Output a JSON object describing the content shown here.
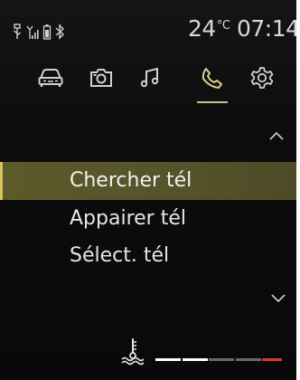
{
  "status_bar": {
    "icons": [
      "usb-icon",
      "signal-icon",
      "battery-icon",
      "bluetooth-icon"
    ],
    "temperature_value": "24",
    "temperature_unit": "°C",
    "time": "07:14"
  },
  "tabs": [
    {
      "name": "vehicle",
      "icon": "car-icon",
      "selected": false
    },
    {
      "name": "camera",
      "icon": "camera-icon",
      "selected": false
    },
    {
      "name": "music",
      "icon": "music-note-icon",
      "selected": false
    },
    {
      "name": "phone",
      "icon": "phone-icon",
      "selected": true
    },
    {
      "name": "settings",
      "icon": "gear-icon",
      "selected": false
    }
  ],
  "menu": {
    "items": [
      {
        "label": "Chercher tél",
        "selected": true
      },
      {
        "label": "Appairer tél",
        "selected": false
      },
      {
        "label": "Sélect. tél",
        "selected": false
      }
    ],
    "scroll_up_icon": "chevron-up-icon",
    "scroll_down_icon": "chevron-down-icon"
  },
  "coolant_gauge": {
    "icon": "coolant-temperature-icon",
    "segments": [
      {
        "state": "lit",
        "color": "#ffffff"
      },
      {
        "state": "lit",
        "color": "#ffffff"
      },
      {
        "state": "dim",
        "color": "#6a6a6a"
      },
      {
        "state": "dim",
        "color": "#6a6a6a"
      },
      {
        "state": "warning",
        "color": "#d23a2a"
      }
    ]
  },
  "colors": {
    "accent": "#c9c08a",
    "selected_row": "#5c5a2a",
    "text": "#e6e6e6"
  }
}
